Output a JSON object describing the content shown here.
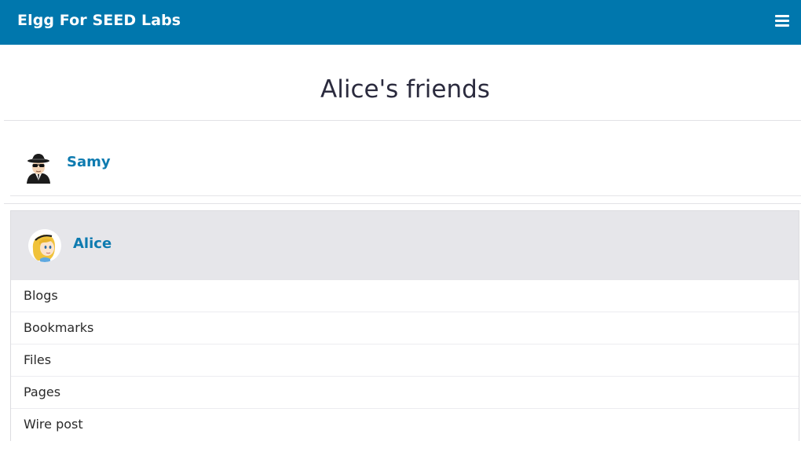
{
  "topbar": {
    "site_name": "Elgg For SEED Labs",
    "menu_icon": "hamburger-menu-icon",
    "background_color": "#0077ad"
  },
  "page": {
    "title": "Alice's friends"
  },
  "friends": [
    {
      "name": "Samy",
      "avatar": "spy-avatar"
    }
  ],
  "owner": {
    "name": "Alice",
    "avatar": "alice-avatar",
    "menu": [
      {
        "label": "Blogs"
      },
      {
        "label": "Bookmarks"
      },
      {
        "label": "Files"
      },
      {
        "label": "Pages"
      },
      {
        "label": "Wire post"
      }
    ]
  },
  "colors": {
    "link": "#0e7bb0",
    "owner_header_bg": "#e6e6ea"
  }
}
